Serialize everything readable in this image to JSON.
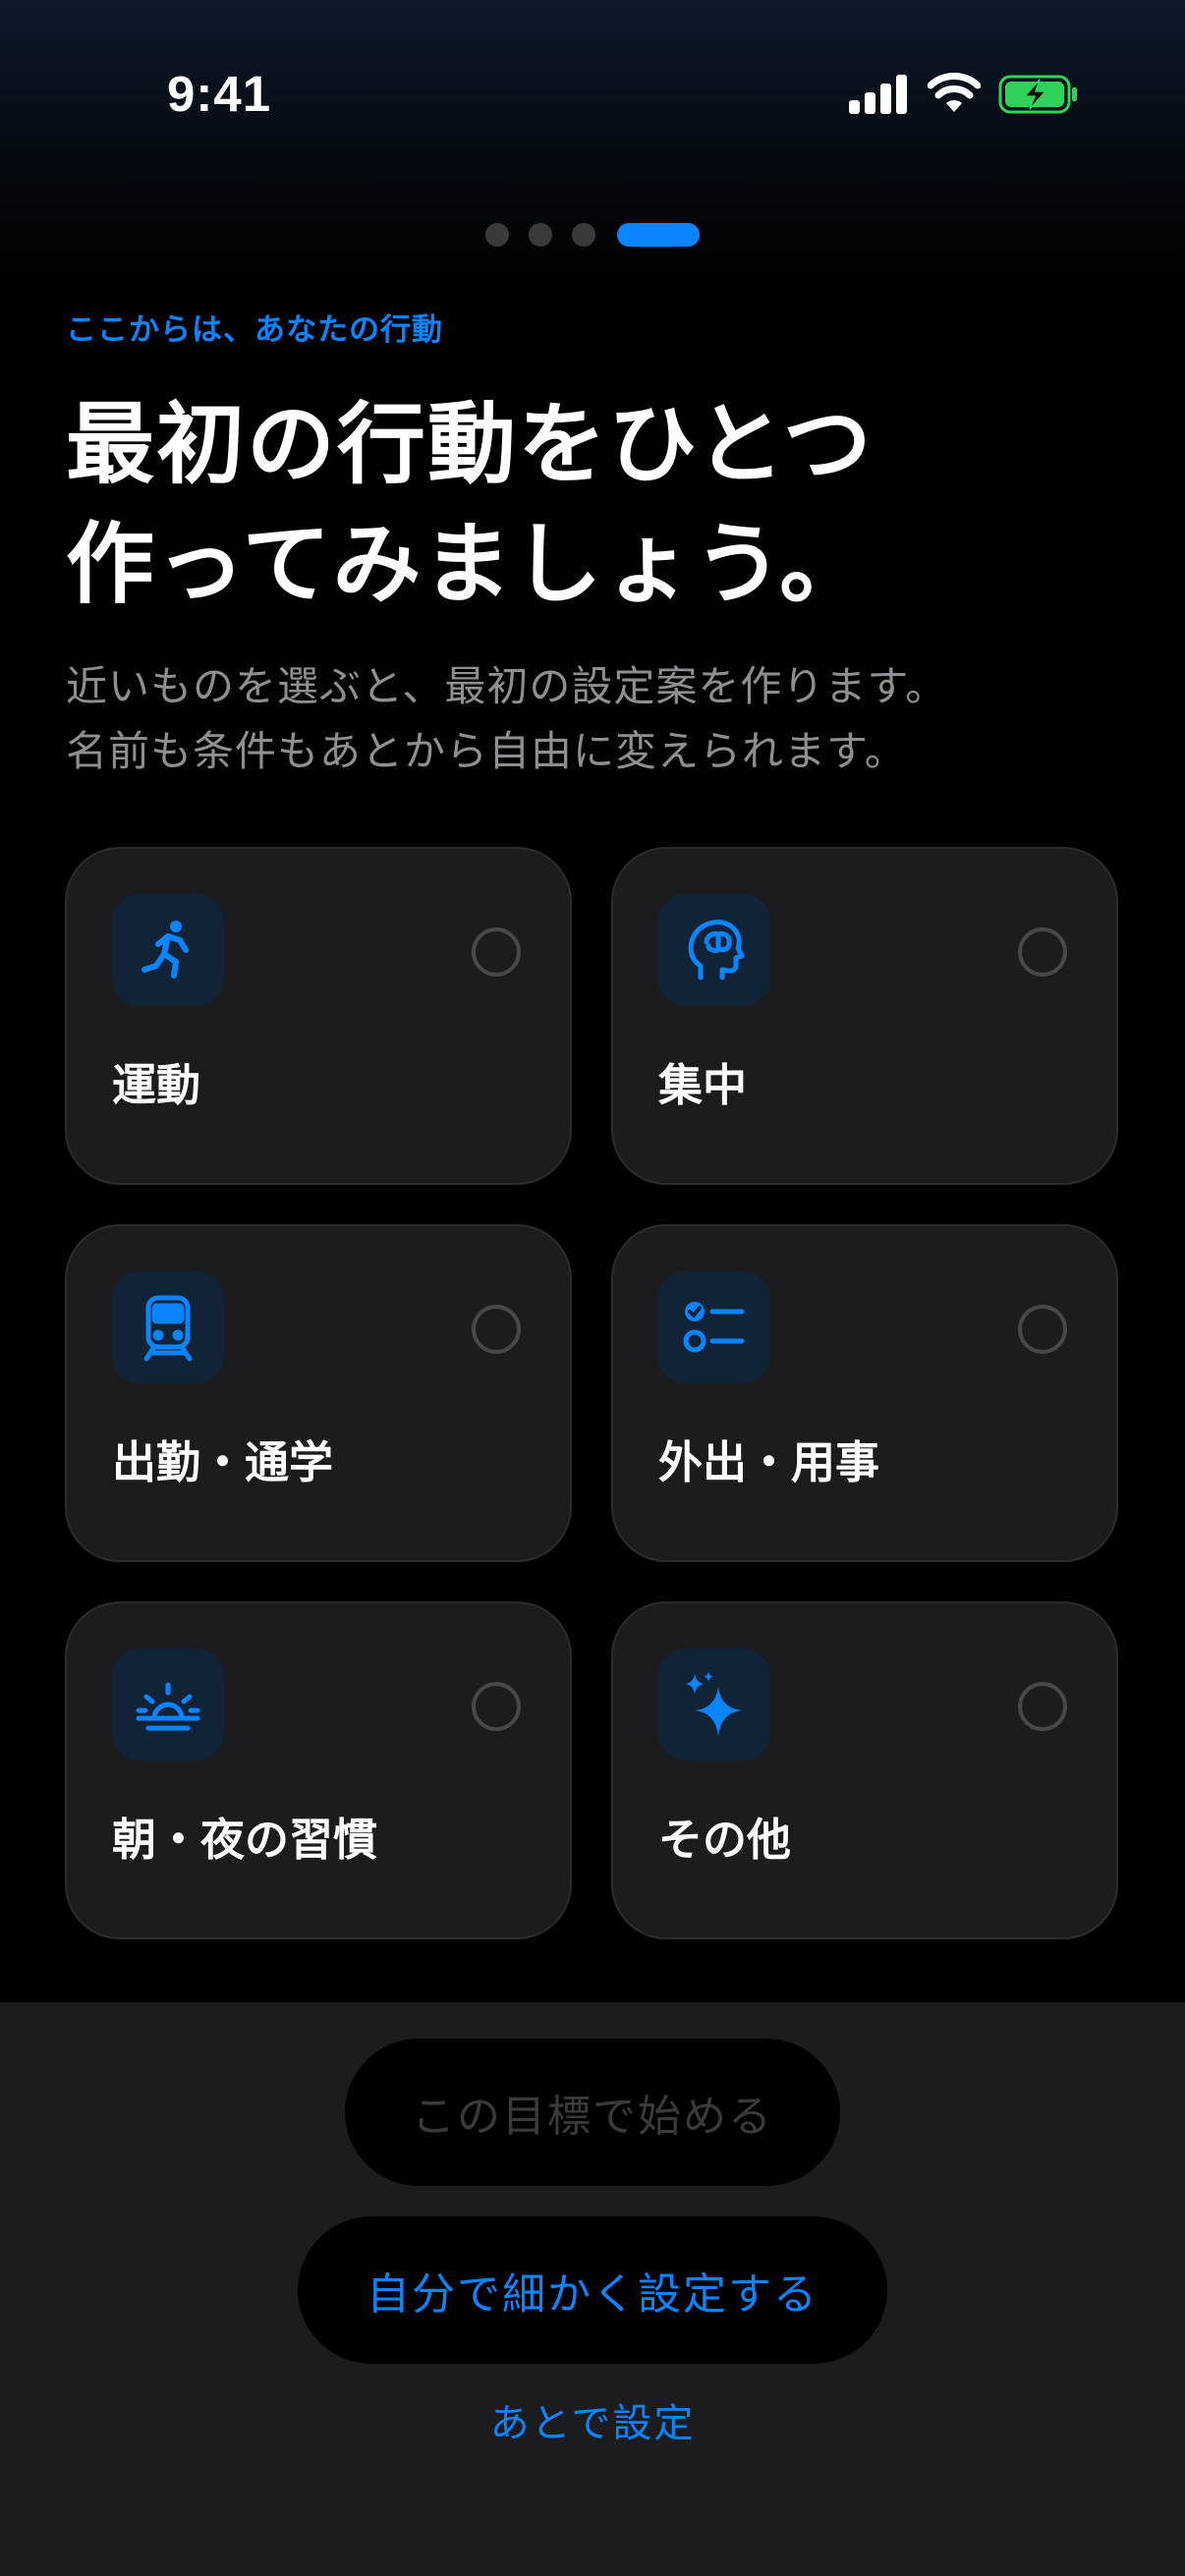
{
  "status_bar": {
    "time": "9:41",
    "icons": [
      "signal-icon",
      "wifi-icon",
      "battery-charging-icon"
    ],
    "battery_color": "#30d158"
  },
  "pager": {
    "total": 4,
    "current": 4
  },
  "header": {
    "eyebrow": "ここからは、あなたの行動",
    "title_line1": "最初の行動をひとつ",
    "title_line2": "作ってみましょう。",
    "subtitle_line1": "近いものを選ぶと、最初の設定案を作ります。",
    "subtitle_line2": "名前も条件もあとから自由に変えられます。"
  },
  "categories": [
    {
      "label": "運動",
      "icon": "running-figure-icon",
      "selected": false
    },
    {
      "label": "集中",
      "icon": "brain-head-icon",
      "selected": false
    },
    {
      "label": "出勤・通学",
      "icon": "train-icon",
      "selected": false
    },
    {
      "label": "外出・用事",
      "icon": "checklist-icon",
      "selected": false
    },
    {
      "label": "朝・夜の習慣",
      "icon": "sunrise-icon",
      "selected": false
    },
    {
      "label": "その他",
      "icon": "sparkles-icon",
      "selected": false
    }
  ],
  "actions": {
    "primary_label": "この目標で始める",
    "primary_enabled": false,
    "secondary_label": "自分で細かく設定する",
    "later_label": "あとで設定"
  },
  "colors": {
    "accent": "#0a84ff",
    "card_bg": "#1c1c1e",
    "icon_tile_bg": "#102337",
    "secondary_text": "#8e8e93"
  }
}
